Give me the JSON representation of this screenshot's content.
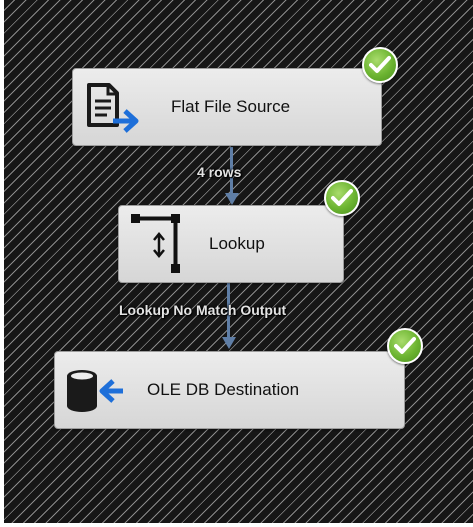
{
  "data_flow": {
    "components": [
      {
        "label": "Flat File Source",
        "status": "success",
        "icon": "flat-file-source-icon"
      },
      {
        "label": "Lookup",
        "status": "success",
        "icon": "lookup-icon"
      },
      {
        "label": "OLE DB Destination",
        "status": "success",
        "icon": "ole-db-destination-icon"
      }
    ],
    "paths": [
      {
        "label": "4 rows"
      },
      {
        "label": "Lookup No Match Output"
      }
    ]
  },
  "colors": {
    "canvas_background": "#161616",
    "path_color": "#5f7ea6",
    "success_check": "#6cb431"
  }
}
